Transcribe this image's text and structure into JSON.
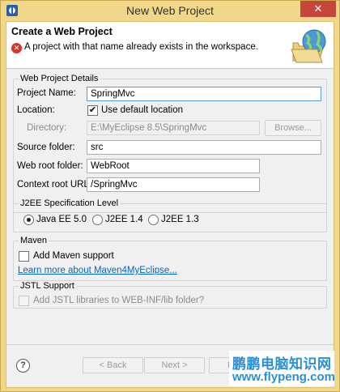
{
  "window": {
    "title": "New Web Project",
    "close_glyph": "✕"
  },
  "banner": {
    "heading": "Create a Web Project",
    "error_glyph": "✕",
    "error_message": "A project with that name already exists in the workspace."
  },
  "details": {
    "group_title": "Web Project Details",
    "project_name_label": "Project Name:",
    "project_name_value": "SpringMvc",
    "location_label": "Location:",
    "use_default_location_label": "Use default location",
    "use_default_location_checked": true,
    "directory_label": "Directory:",
    "directory_value": "E:\\MyEclipse 8.5\\SpringMvc",
    "browse_label": "Browse...",
    "source_folder_label": "Source folder:",
    "source_folder_value": "src",
    "web_root_label": "Web root folder:",
    "web_root_value": "WebRoot",
    "context_root_label": "Context root URL:",
    "context_root_value": "/SpringMvc"
  },
  "j2ee": {
    "group_title": "J2EE Specification Level",
    "options": [
      "Java EE 5.0",
      "J2EE 1.4",
      "J2EE 1.3"
    ],
    "selected": "Java EE 5.0"
  },
  "maven": {
    "group_title": "Maven",
    "add_support_label": "Add Maven support",
    "learn_more_link": "Learn more about Maven4MyEclipse..."
  },
  "jstl": {
    "group_title": "JSTL Support",
    "add_jstl_label": "Add JSTL libraries to WEB-INF/lib folder?"
  },
  "footer": {
    "help_glyph": "?",
    "back_label": "< Back",
    "next_label": "Next >",
    "finish_label": "Fi"
  },
  "watermark": {
    "line1": "鹏鹏电脑知识网",
    "line2": "www.flypeng.com"
  },
  "colors": {
    "frame": "#f0d78a",
    "close": "#c7463b",
    "error": "#d9332a",
    "link": "#0066cc",
    "watermark": "#2b8fd6"
  }
}
